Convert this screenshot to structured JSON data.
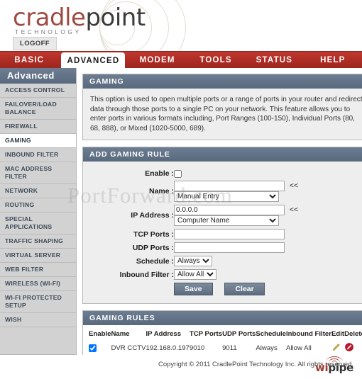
{
  "header": {
    "logo_primary": "cradle",
    "logo_secondary": "point",
    "logo_subtitle": "TECHNOLOGY",
    "logoff_label": "LOGOFF",
    "brand_red": "#9e4b42",
    "brand_dark": "#3b3b3b"
  },
  "nav": {
    "tabs": [
      {
        "label": "BASIC",
        "active": false
      },
      {
        "label": "ADVANCED",
        "active": true
      },
      {
        "label": "MODEM",
        "active": false
      },
      {
        "label": "TOOLS",
        "active": false
      },
      {
        "label": "STATUS",
        "active": false
      },
      {
        "label": "HELP",
        "active": false
      }
    ],
    "bar_color": "#b02e26"
  },
  "sidebar": {
    "title": "Advanced",
    "items": [
      {
        "label": "ACCESS CONTROL",
        "active": false
      },
      {
        "label": "FAILOVER/LOAD BALANCE",
        "active": false
      },
      {
        "label": "FIREWALL",
        "active": false
      },
      {
        "label": "GAMING",
        "active": true
      },
      {
        "label": "INBOUND FILTER",
        "active": false
      },
      {
        "label": "MAC ADDRESS FILTER",
        "active": false
      },
      {
        "label": "NETWORK",
        "active": false
      },
      {
        "label": "ROUTING",
        "active": false
      },
      {
        "label": "SPECIAL APPLICATIONS",
        "active": false
      },
      {
        "label": "TRAFFIC SHAPING",
        "active": false
      },
      {
        "label": "VIRTUAL SERVER",
        "active": false
      },
      {
        "label": "WEB FILTER",
        "active": false
      },
      {
        "label": "WIRELESS (WI-FI)",
        "active": false
      },
      {
        "label": "WI-FI PROTECTED SETUP",
        "active": false
      },
      {
        "label": "WISH",
        "active": false
      }
    ]
  },
  "gaming_panel": {
    "title": "GAMING",
    "description": "This option is used to open multiple ports or a range of ports in your router and redirect data through those ports to a single PC on your network. This feature allows you to enter ports in various formats including, Port Ranges (100-150), Individual Ports (80, 68, 888), or Mixed (1020-5000, 689)."
  },
  "add_rule_panel": {
    "title": "ADD GAMING RULE",
    "fields": {
      "enable_label": "Enable :",
      "enable_checked": false,
      "name_label": "Name :",
      "name_value": "",
      "name_placeholder": "",
      "name_arrows": "<<",
      "name_select_value": "Manual Entry",
      "name_select_options": [
        "Manual Entry"
      ],
      "ip_label": "IP Address :",
      "ip_value": "0.0.0.0",
      "ip_arrows": "<<",
      "ip_select_value": "Computer Name",
      "ip_select_options": [
        "Computer Name"
      ],
      "tcp_label": "TCP Ports :",
      "tcp_value": "",
      "udp_label": "UDP Ports :",
      "udp_value": "",
      "schedule_label": "Schedule :",
      "schedule_value": "Always",
      "schedule_options": [
        "Always"
      ],
      "inbound_label": "Inbound Filter :",
      "inbound_value": "Allow All",
      "inbound_options": [
        "Allow All"
      ]
    },
    "save_label": "Save",
    "clear_label": "Clear"
  },
  "rules_panel": {
    "title": "GAMING RULES",
    "columns": [
      "Enable",
      "Name",
      "IP Address",
      "TCP Ports",
      "UDP Ports",
      "Schedule",
      "Inbound Filter",
      "Edit",
      "Delete"
    ],
    "rows": [
      {
        "enable": true,
        "name": "DVR CCTV",
        "ip_address": "192.168.0.197",
        "tcp_ports": "9010",
        "udp_ports": "9011",
        "schedule": "Always",
        "inbound_filter": "Allow All",
        "edit_icon": "pencil-icon",
        "delete_icon": "delete-circle-icon"
      }
    ]
  },
  "footer": {
    "copyright": "Copyright © 2011 CradlePoint Technology Inc. All rights reserved.",
    "wipipe_primary": "wi",
    "wipipe_secondary": "pipe"
  },
  "watermark": {
    "text": "PortForward.com"
  }
}
